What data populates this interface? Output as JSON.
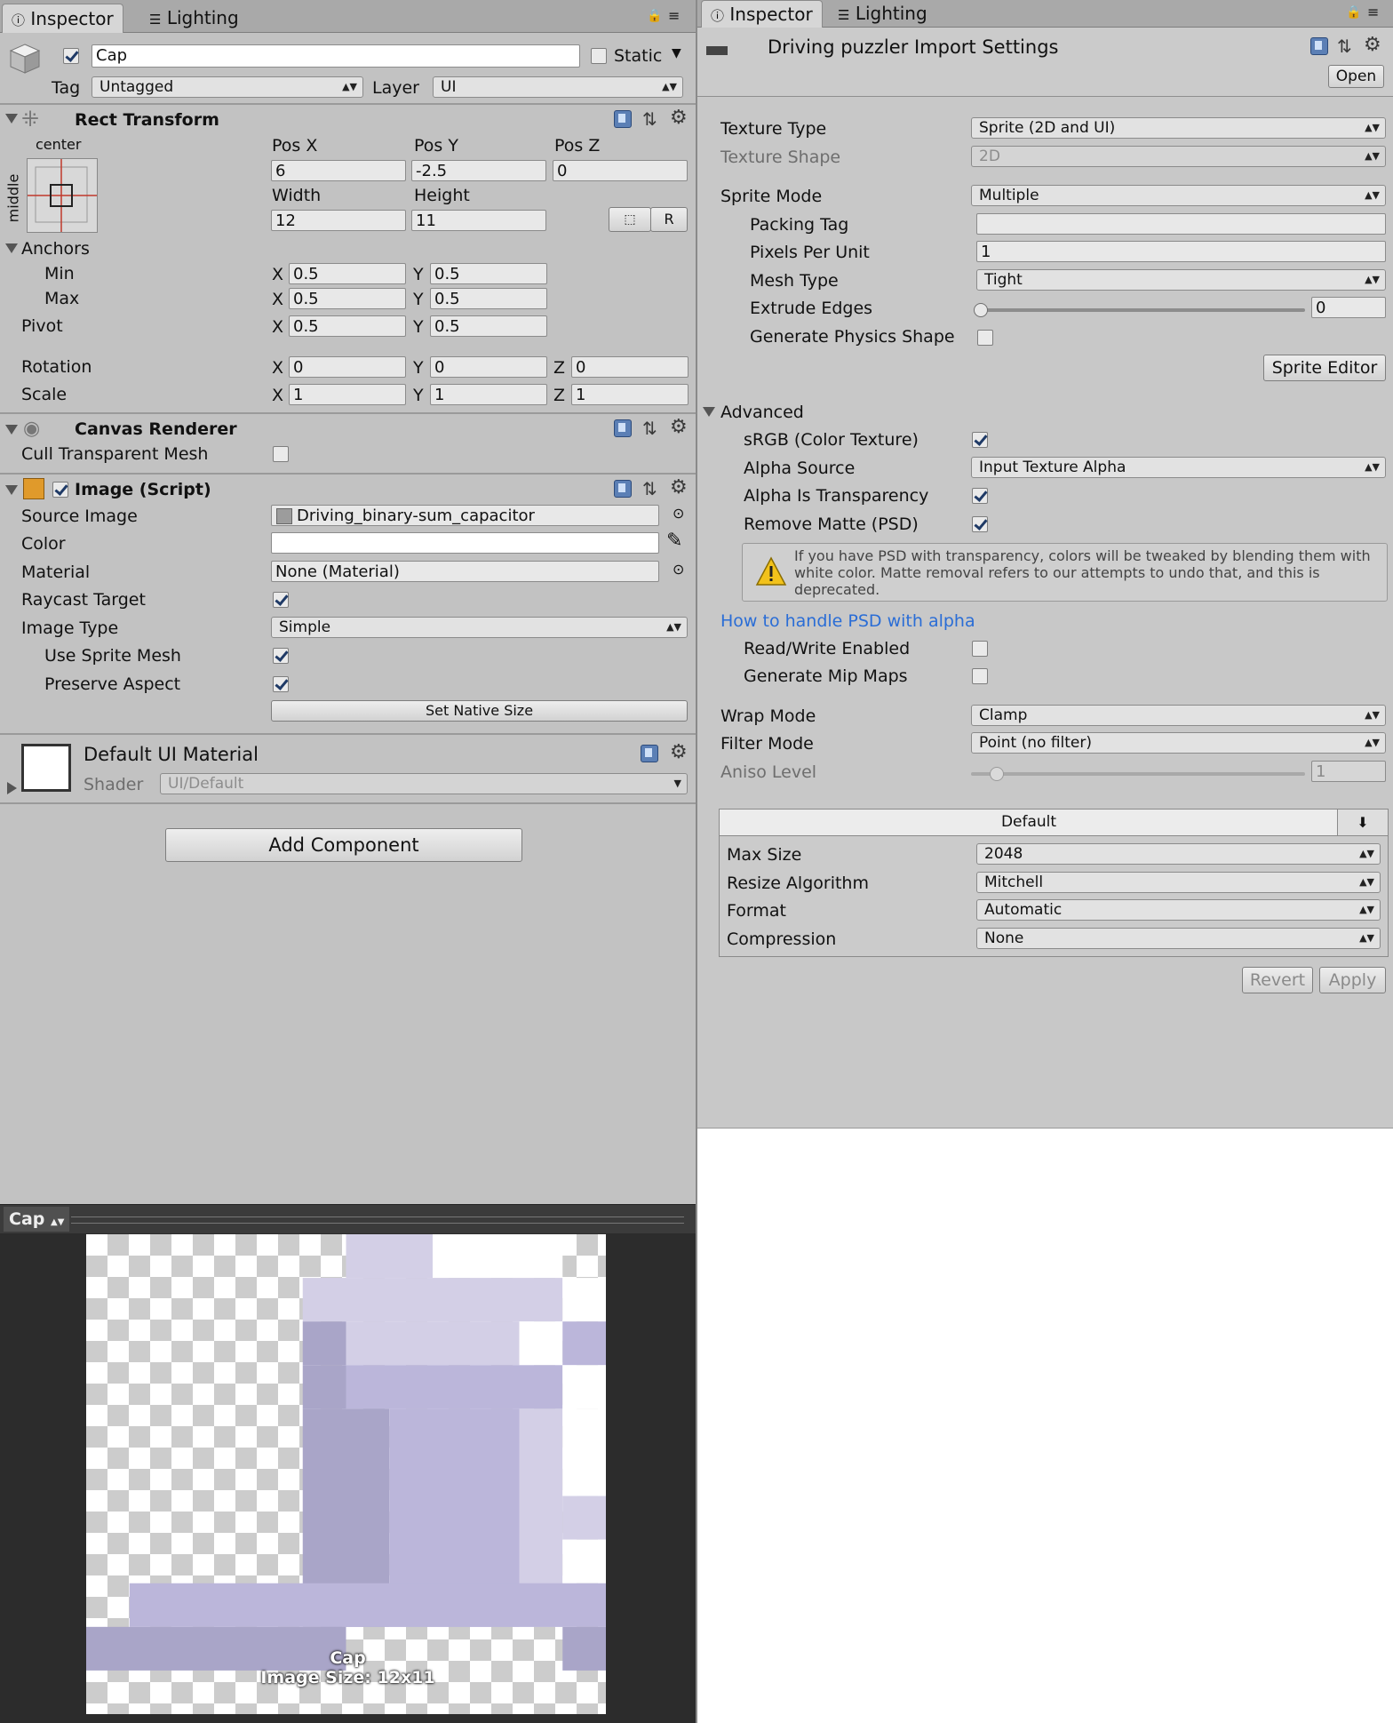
{
  "left": {
    "tabs": [
      "Inspector",
      "Lighting"
    ],
    "object": {
      "active": true,
      "name": "Cap",
      "static_label": "Static",
      "tag_label": "Tag",
      "tag_value": "Untagged",
      "layer_label": "Layer",
      "layer_value": "UI"
    },
    "rect_transform": {
      "title": "Rect Transform",
      "anchor_preset_h": "center",
      "anchor_preset_v": "middle",
      "pos_x_label": "Pos X",
      "pos_y_label": "Pos Y",
      "pos_z_label": "Pos Z",
      "pos_x": "6",
      "pos_y": "-2.5",
      "pos_z": "0",
      "width_label": "Width",
      "height_label": "Height",
      "width": "12",
      "height": "11",
      "r_button": "R",
      "anchors_label": "Anchors",
      "min_label": "Min",
      "max_label": "Max",
      "pivot_label": "Pivot",
      "x": "X",
      "y": "Y",
      "z": "Z",
      "min_x": "0.5",
      "min_y": "0.5",
      "max_x": "0.5",
      "max_y": "0.5",
      "pivot_x": "0.5",
      "pivot_y": "0.5",
      "rotation_label": "Rotation",
      "rot_x": "0",
      "rot_y": "0",
      "rot_z": "0",
      "scale_label": "Scale",
      "scale_x": "1",
      "scale_y": "1",
      "scale_z": "1"
    },
    "canvas_renderer": {
      "title": "Canvas Renderer",
      "cull_label": "Cull Transparent Mesh",
      "cull": false
    },
    "image": {
      "title": "Image (Script)",
      "source_label": "Source Image",
      "source_value": "Driving_binary-sum_capacitor",
      "color_label": "Color",
      "material_label": "Material",
      "material_value": "None (Material)",
      "raycast_label": "Raycast Target",
      "type_label": "Image Type",
      "type_value": "Simple",
      "use_sprite_mesh_label": "Use Sprite Mesh",
      "preserve_label": "Preserve Aspect",
      "native_btn": "Set Native Size"
    },
    "material": {
      "title": "Default UI Material",
      "shader_label": "Shader",
      "shader_value": "UI/Default"
    },
    "add_component": "Add Component",
    "preview": {
      "title": "Cap",
      "caption_name": "Cap",
      "caption_size": "Image Size: 12x11"
    }
  },
  "right": {
    "tabs": [
      "Inspector",
      "Lighting"
    ],
    "title": "Driving puzzler Import Settings",
    "open_btn": "Open",
    "texture_type_label": "Texture Type",
    "texture_type": "Sprite (2D and UI)",
    "texture_shape_label": "Texture Shape",
    "texture_shape": "2D",
    "sprite_mode_label": "Sprite Mode",
    "sprite_mode": "Multiple",
    "packing_tag_label": "Packing Tag",
    "packing_tag": "",
    "ppu_label": "Pixels Per Unit",
    "ppu": "1",
    "mesh_type_label": "Mesh Type",
    "mesh_type": "Tight",
    "extrude_label": "Extrude Edges",
    "extrude": "0",
    "physics_label": "Generate Physics Shape",
    "sprite_editor_btn": "Sprite Editor",
    "advanced_label": "Advanced",
    "srgb_label": "sRGB (Color Texture)",
    "alpha_source_label": "Alpha Source",
    "alpha_source": "Input Texture Alpha",
    "alpha_transp_label": "Alpha Is Transparency",
    "remove_matte_label": "Remove Matte (PSD)",
    "warning": "If you have PSD with transparency, colors will be tweaked by blending them with white color. Matte removal refers to our attempts to undo that, and this is deprecated.",
    "psd_link": "How to handle PSD with alpha",
    "rw_label": "Read/Write Enabled",
    "mip_label": "Generate Mip Maps",
    "wrap_label": "Wrap Mode",
    "wrap": "Clamp",
    "filter_label": "Filter Mode",
    "filter": "Point (no filter)",
    "aniso_label": "Aniso Level",
    "aniso": "1",
    "platform_tab": "Default",
    "max_size_label": "Max Size",
    "max_size": "2048",
    "resize_label": "Resize Algorithm",
    "resize": "Mitchell",
    "format_label": "Format",
    "format": "Automatic",
    "compression_label": "Compression",
    "compression": "None",
    "revert_btn": "Revert",
    "apply_btn": "Apply"
  },
  "checkbox_states": {
    "raycast": true,
    "use_sprite_mesh": true,
    "preserve": true,
    "physics": false,
    "srgb": true,
    "alpha_transp": true,
    "remove_matte": true,
    "rw": false,
    "mip": false
  },
  "colors": {
    "sprite_light": "#d3cfe6",
    "sprite_mid": "#bbb6da",
    "sprite_dark": "#a9a5c8",
    "link": "#2a6dd6"
  }
}
